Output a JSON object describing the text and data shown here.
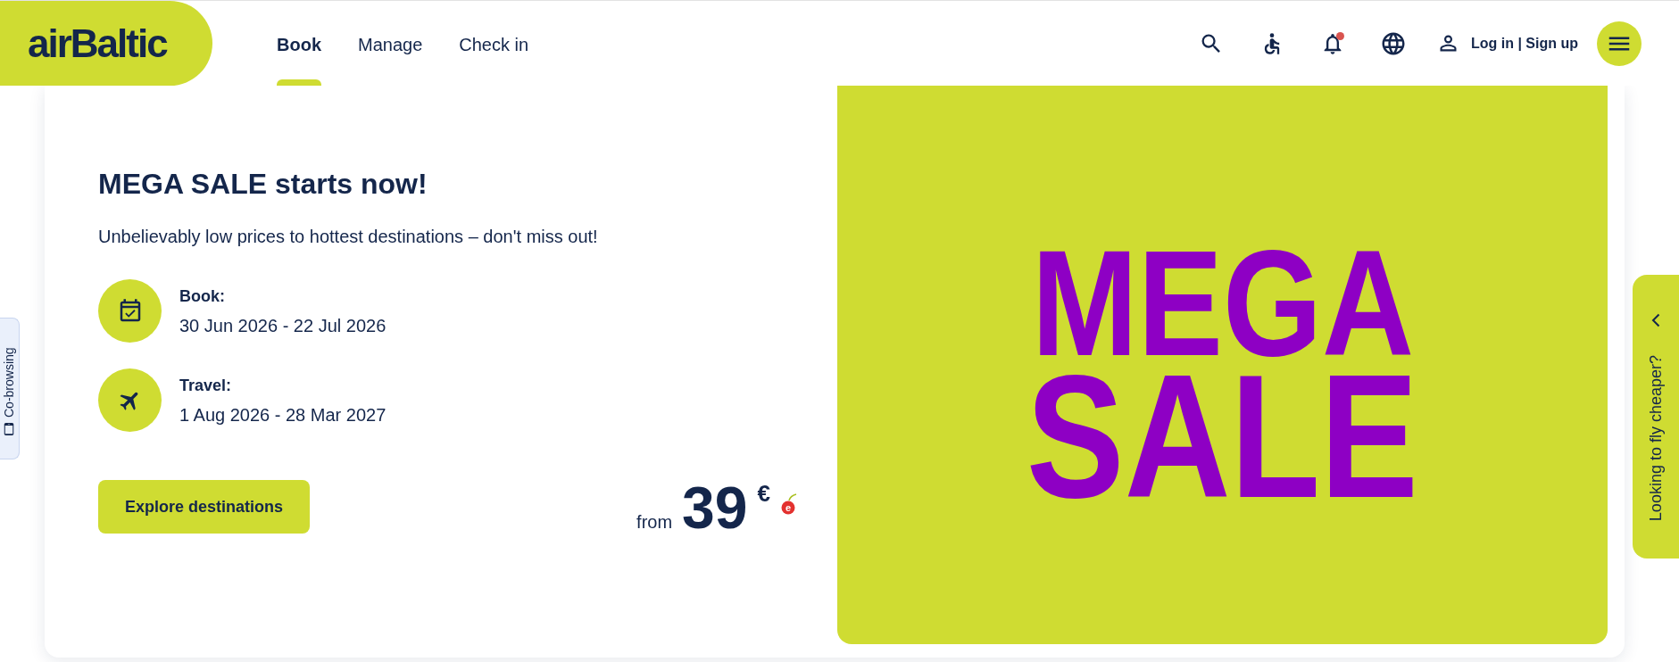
{
  "header": {
    "logo": "airBaltic",
    "nav": [
      {
        "label": "Book",
        "selected": true
      },
      {
        "label": "Manage",
        "selected": false
      },
      {
        "label": "Check in",
        "selected": false
      }
    ],
    "notifications_unread": true,
    "login": "Log in | Sign up"
  },
  "promo": {
    "title": "MEGA SALE starts now!",
    "subtitle": "Unbelievably low prices to hottest destinations – don't miss out!",
    "periods": [
      {
        "kind": "booking",
        "label": "Book:",
        "dates": "30 Jun 2026 - 22 Jul 2026"
      },
      {
        "kind": "travel",
        "label": "Travel:",
        "dates": "1 Aug 2026 - 28 Mar 2027"
      }
    ],
    "button": "Explore destinations",
    "price": {
      "prefix": "from",
      "amount": "39",
      "currency": "€",
      "badge": "e"
    },
    "banner": {
      "lines": [
        "MEGA",
        "SALE"
      ]
    }
  },
  "cobrowse_tab": {
    "label": "Co-browsing"
  },
  "cheaper_tab": {
    "label": "Looking to fly cheaper?"
  }
}
